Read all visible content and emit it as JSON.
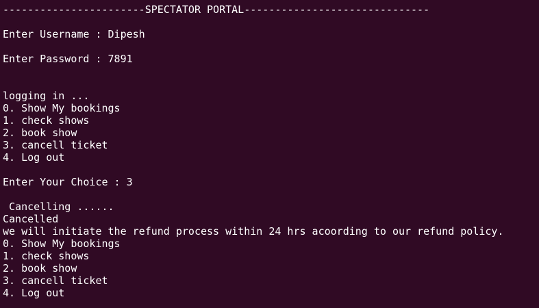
{
  "terminal": {
    "background": "#300a24",
    "foreground": "#ffffff",
    "lines": [
      "-----------------------SPECTATOR PORTAL------------------------------",
      "",
      "Enter Username : Dipesh",
      "",
      "Enter Password : 7891",
      "",
      "",
      "logging in ...",
      "0. Show My bookings",
      "1. check shows",
      "2. book show",
      "3. cancell ticket",
      "4. Log out",
      "",
      "Enter Your Choice : 3",
      "",
      " Cancelling ......",
      "Cancelled",
      "we will initiate the refund process within 24 hrs acoording to our refund policy.",
      "0. Show My bookings",
      "1. check shows",
      "2. book show",
      "3. cancell ticket",
      "4. Log out"
    ]
  }
}
